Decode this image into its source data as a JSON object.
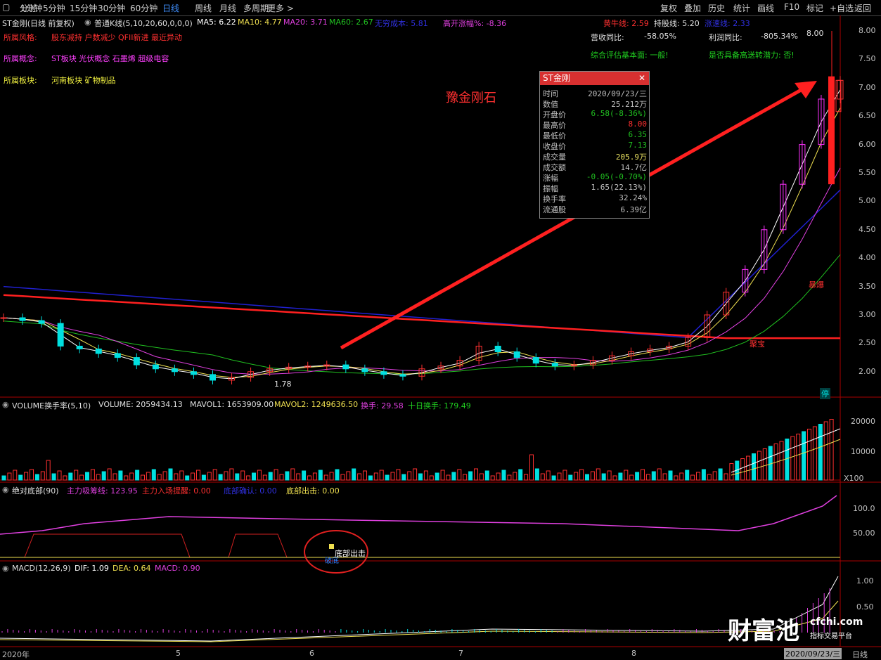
{
  "toolbar": {
    "left": [
      "分时",
      "1分钟",
      "5分钟",
      "15分钟",
      "30分钟",
      "60分钟",
      "日线",
      "周线",
      "月线",
      "多周期",
      "更多 >"
    ],
    "active": "日线",
    "right": [
      "复权",
      "叠加",
      "历史",
      "统计",
      "画线",
      "F10",
      "标记",
      "+自选",
      "返回"
    ]
  },
  "header": {
    "stock": "ST金刚(日线 前复权)",
    "kline_label": "普通K线(5,10,20,60,0,0,0)",
    "ma5": "MA5: 6.22",
    "ma10": "MA10: 4.77",
    "ma20": "MA20: 3.71",
    "ma60": "MA60: 2.67",
    "cost": "无穷成本: 5.81",
    "open_pct": "高开涨幅%: -8.36",
    "bull_line": "黄牛线: 2.59",
    "hold_line": "持股线: 5.20",
    "support_line": "涨速线: 2.33"
  },
  "fundamentals": {
    "style_label": "所属风格:",
    "style_value": "股东减持 户数减少 QFII新进 最近异动",
    "concept_label": "所属概念:",
    "concept_value": "ST板块 光伏概念 石墨烯 超级电容",
    "sector_label": "所属板块:",
    "sector_value": "河南板块   矿物制品",
    "rev_label": "营收同比:",
    "rev_value": "-58.05%",
    "profit_label": "利润同比:",
    "profit_value": "-805.34%",
    "rating": "综合评估基本面: 一般!",
    "transfer": "是否具备高送转潜力: 否!"
  },
  "annotation_text": "豫金刚石",
  "popup": {
    "title": "ST金刚",
    "rows": [
      {
        "k": "时间",
        "v": "2020/09/23/三",
        "c": "#c0c0c0"
      },
      {
        "k": "数值",
        "v": "25.212万",
        "c": "#c0c0c0"
      },
      {
        "k": "开盘价",
        "v": "6.58(-8.36%)",
        "c": "#20c020"
      },
      {
        "k": "最高价",
        "v": "8.00",
        "c": "#ff3030"
      },
      {
        "k": "最低价",
        "v": "6.35",
        "c": "#20c020"
      },
      {
        "k": "收盘价",
        "v": "7.13",
        "c": "#20c020"
      },
      {
        "k": "成交量",
        "v": "205.9万",
        "c": "#e8e060"
      },
      {
        "k": "成交额",
        "v": "14.7亿",
        "c": "#c0c0c0"
      },
      {
        "k": "涨幅",
        "v": "-0.05(-0.70%)",
        "c": "#20c020"
      },
      {
        "k": "振幅",
        "v": "1.65(22.13%)",
        "c": "#c0c0c0"
      },
      {
        "k": "换手率",
        "v": "32.24%",
        "c": "#c0c0c0"
      },
      {
        "k": "流通股",
        "v": "6.39亿",
        "c": "#c0c0c0"
      }
    ]
  },
  "price_axis": [
    "8.00",
    "7.50",
    "7.00",
    "6.50",
    "6.00",
    "5.50",
    "5.00",
    "4.50",
    "4.00",
    "3.50",
    "3.00",
    "2.50",
    "2.00"
  ],
  "high_label": "8.00",
  "low_label": "1.78",
  "tags": {
    "stop": "停",
    "burst": "暴爆",
    "treasure": "聚宝"
  },
  "volume": {
    "label": "VOLUME换手率(5,10)",
    "volume": "VOLUME: 2059434.13",
    "mavol1": "MAVOL1: 1653909.00",
    "mavol2": "MAVOL2: 1249636.50",
    "turnover": "换手: 29.58",
    "ten_day": "十日换手: 179.49",
    "axis": [
      "20000",
      "10000"
    ],
    "unit": "X100"
  },
  "bottom_ind": {
    "label": "绝对底部(90)",
    "absorb": "主力吸筹线: 123.95",
    "enter": "主力入场提醒: 0.00",
    "confirm": "底部确认: 0.00",
    "out": "底部出击: 0.00",
    "axis": [
      "100.0",
      "50.00"
    ],
    "signal": "底部出击",
    "signal2": "破底"
  },
  "macd": {
    "label": "MACD(12,26,9)",
    "dif": "DIF: 1.09",
    "dea": "DEA: 0.64",
    "macd": "MACD: 0.90",
    "axis": [
      "1.00",
      "0.50"
    ]
  },
  "date_axis": {
    "labels": [
      "2020年",
      "5",
      "6",
      "7",
      "8"
    ],
    "current": "2020/09/23/三",
    "period": "日线"
  },
  "watermark": {
    "brand": "财富池",
    "site": "cfchi.com",
    "tagline": "指标交易平台"
  },
  "colors": {
    "up": "#ff3030",
    "down": "#00e0e0",
    "ma5": "#ffffff",
    "ma10": "#f0e050",
    "ma20": "#e040e0",
    "ma60": "#20c020",
    "magenta_bar": "#ff30ff",
    "red_line": "#ff2020",
    "blue_line": "#2020d0"
  },
  "chart_data": {
    "type": "candlestick",
    "title": "ST金刚(日线 前复权)",
    "ylim": [
      1.6,
      8.2
    ],
    "x_range": [
      "2020-04",
      "2020-09-23"
    ],
    "notable_points": {
      "low": 1.78,
      "high": 8.0
    },
    "last_bar": {
      "date": "2020/09/23",
      "open": 6.58,
      "high": 8.0,
      "low": 6.35,
      "close": 7.13
    },
    "closes_sample": [
      2.95,
      2.9,
      2.85,
      2.45,
      2.4,
      2.32,
      2.25,
      2.12,
      2.05,
      2.0,
      1.95,
      1.85,
      1.9,
      2.0,
      2.05,
      2.08,
      2.1,
      2.12,
      2.05,
      2.0,
      1.95,
      1.92,
      2.05,
      2.1,
      2.2,
      2.45,
      2.35,
      2.25,
      2.15,
      2.1,
      2.12,
      2.2,
      2.28,
      2.35,
      2.4,
      2.45,
      2.6,
      3.0,
      3.4,
      3.8,
      4.5,
      5.3,
      6.0,
      6.8,
      7.13
    ]
  }
}
